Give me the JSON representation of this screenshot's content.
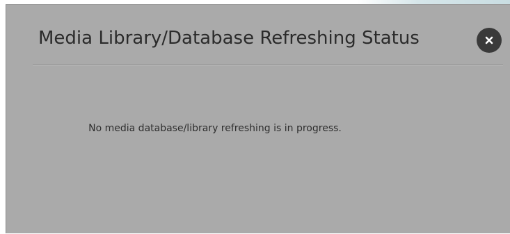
{
  "dialog": {
    "title": "Media Library/Database Refreshing Status",
    "close_icon": "close-icon",
    "message": "No media database/library refreshing is in progress."
  },
  "colors": {
    "dialog_background": "#aaaaaa",
    "title_text": "#2b2b2b",
    "close_button_background": "#3a3a3a",
    "close_glyph": "#ffffff",
    "message_text": "#2e2e2e"
  }
}
